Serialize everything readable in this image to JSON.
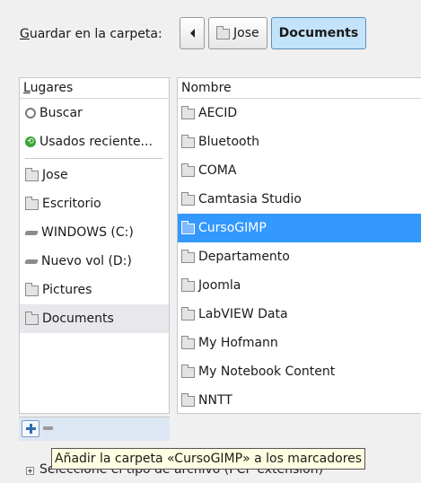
{
  "header": {
    "save_label_accel": "G",
    "save_label_rest": "uardar en la carpeta:",
    "path": [
      "Jose",
      "Documents"
    ]
  },
  "places": {
    "header_accel": "L",
    "header_rest": "ugares",
    "items": [
      {
        "label": "Buscar",
        "icon": "search-icon"
      },
      {
        "label": "Usados reciente...",
        "icon": "recent-icon"
      },
      {
        "label": "Jose",
        "icon": "folder-icon"
      },
      {
        "label": "Escritorio",
        "icon": "folder-icon"
      },
      {
        "label": "WINDOWS (C:)",
        "icon": "drive-icon"
      },
      {
        "label": "Nuevo vol (D:)",
        "icon": "drive-icon"
      },
      {
        "label": "Pictures",
        "icon": "folder-icon"
      },
      {
        "label": "Documents",
        "icon": "folder-icon"
      }
    ]
  },
  "files": {
    "header": "Nombre",
    "items": [
      "AECID",
      "Bluetooth",
      "COMA",
      "Camtasia Studio",
      "CursoGIMP",
      "Departamento",
      "Joomla",
      "LabVIEW Data",
      "My Hofmann",
      "My Notebook Content",
      "NNTT"
    ],
    "selected": "CursoGIMP"
  },
  "bottom": {
    "filter_label": "Seleccione el tipo de archivo (PCP extension)"
  },
  "tooltip": "Añadir la carpeta «CursoGIMP» a los marcadores"
}
